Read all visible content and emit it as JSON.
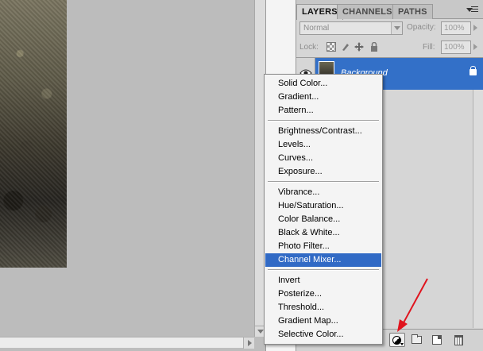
{
  "panel": {
    "tabs": [
      {
        "label": "LAYERS"
      },
      {
        "label": "CHANNELS"
      },
      {
        "label": "PATHS"
      }
    ],
    "blend_mode": "Normal",
    "opacity_label": "Opacity:",
    "opacity_value": "100%",
    "lock_label": "Lock:",
    "fill_label": "Fill:",
    "fill_value": "100%",
    "layer": {
      "name": "Background"
    }
  },
  "menu": {
    "items": [
      {
        "label": "Solid Color..."
      },
      {
        "label": "Gradient..."
      },
      {
        "label": "Pattern..."
      },
      {
        "label": "Brightness/Contrast..."
      },
      {
        "label": "Levels..."
      },
      {
        "label": "Curves..."
      },
      {
        "label": "Exposure..."
      },
      {
        "label": "Vibrance..."
      },
      {
        "label": "Hue/Saturation..."
      },
      {
        "label": "Color Balance..."
      },
      {
        "label": "Black & White..."
      },
      {
        "label": "Photo Filter..."
      },
      {
        "label": "Channel Mixer..."
      },
      {
        "label": "Invert"
      },
      {
        "label": "Posterize..."
      },
      {
        "label": "Threshold..."
      },
      {
        "label": "Gradient Map..."
      },
      {
        "label": "Selective Color..."
      }
    ],
    "highlighted": "Channel Mixer..."
  },
  "colors": {
    "selection": "#3370c8",
    "menu_highlight": "#316ac5",
    "annotation_arrow": "#e0141e"
  },
  "icons": {
    "eye": "eye-icon",
    "adjustment": "half-circle-adjustment-icon",
    "group": "folder-icon",
    "new_layer": "new-layer-icon",
    "trash": "trash-icon"
  }
}
